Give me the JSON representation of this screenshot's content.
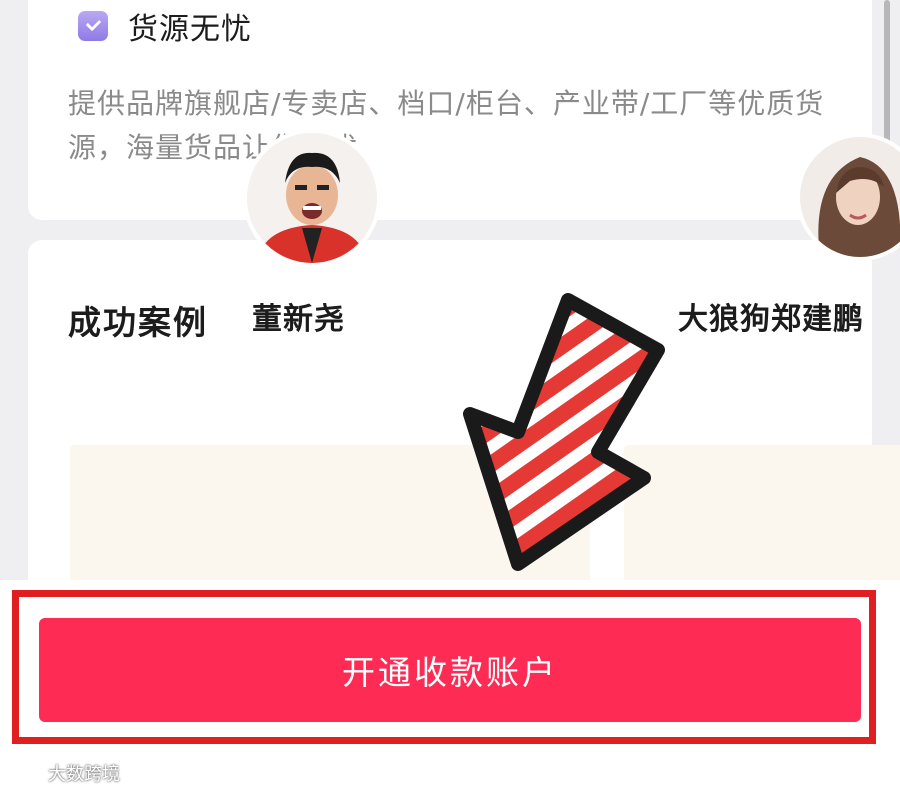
{
  "feature": {
    "title": "货源无忧",
    "icon": "bag-check-icon",
    "description": "提供品牌旗舰店/专卖店、档口/柜台、产业带/工厂等优质货源，海量货品让你无忧"
  },
  "cases": {
    "title": "成功案例",
    "items": [
      {
        "name": "董新尧",
        "avatar": "avatar-man-red-shirt"
      },
      {
        "name": "大狼狗郑建鹏",
        "avatar": "avatar-woman"
      }
    ]
  },
  "cta": {
    "label": "开通收款账户",
    "color": "#fe2c55"
  },
  "annotation": {
    "box_color": "#e02020",
    "arrow": "striped-arrow-icon"
  },
  "watermark": {
    "text": "大数跨境",
    "icon": "watermark-logo-icon"
  }
}
